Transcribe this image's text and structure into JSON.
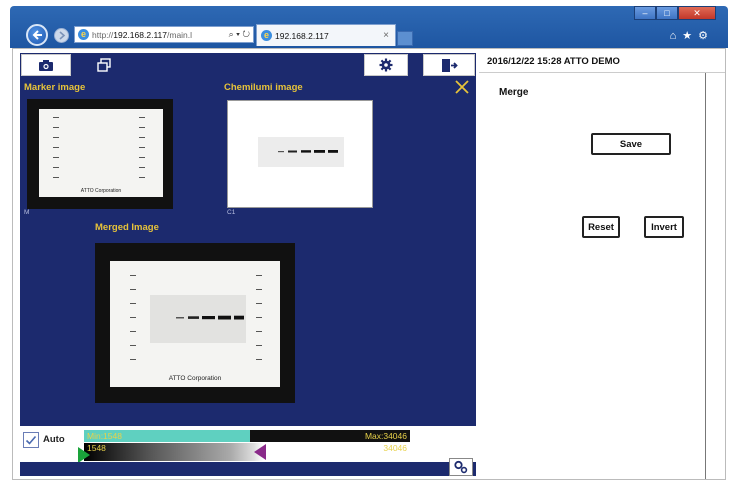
{
  "browser": {
    "url_prefix": "http://",
    "url_host": "192.168.2.117",
    "url_suffix": "/main.l",
    "addr_controls": "⌕ ▾ ↻",
    "tab_title": "192.168.2.117",
    "tab_close": "×",
    "right_icons": "⌂★⚙",
    "window_min": "–",
    "window_max": "□",
    "window_close": "✕"
  },
  "left_panel": {
    "marker_label": "Marker image",
    "chemi_label": "Chemilumi image",
    "merged_label": "Merged Image",
    "marker_code": "M",
    "chemi_code": "C1",
    "corp_small": "ATTO Corporation",
    "corp_large": "ATTO Corporation",
    "auto_label": "Auto",
    "min_label": "Min:1548",
    "max_label": "Max:34046",
    "low_value": "1548",
    "high_value": "34046"
  },
  "right_panel": {
    "header": "2016/12/22 15:28  ATTO DEMO",
    "mode_label": "Merge",
    "save_label": "Save",
    "reset_label": "Reset",
    "invert_label": "Invert"
  },
  "colors": {
    "panel_bg": "#1c2a6e",
    "label_yellow": "#e7c33a",
    "min_cyan": "#5fd0c0"
  },
  "icons": [
    "camera-icon",
    "windows-icon",
    "gear-icon",
    "exit-door-icon",
    "close-icon",
    "checkmark-icon",
    "settings-gears-icon"
  ]
}
